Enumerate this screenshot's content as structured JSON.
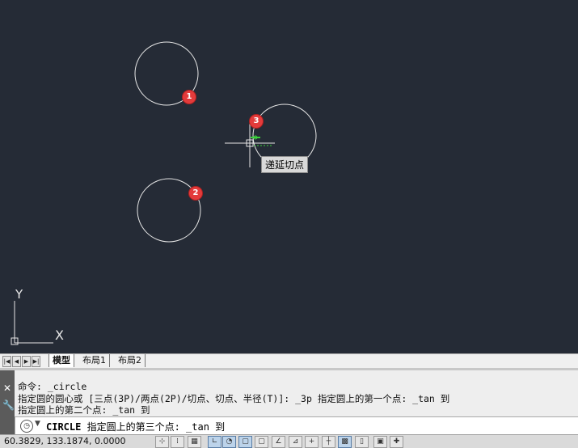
{
  "viewport": {
    "background": "#252b36",
    "markers": [
      {
        "label": "1",
        "color": "#e33b3b"
      },
      {
        "label": "2",
        "color": "#e33b3b"
      },
      {
        "label": "3",
        "color": "#e33b3b"
      }
    ],
    "tooltip": "递延切点",
    "ucs": {
      "x_label": "X",
      "y_label": "Y"
    }
  },
  "tabs": {
    "nav_icons": [
      "first-icon",
      "prev-icon",
      "next-icon",
      "last-icon"
    ],
    "items": [
      {
        "label": "模型",
        "active": true
      },
      {
        "label": "布局1",
        "active": false
      },
      {
        "label": "布局2",
        "active": false
      }
    ]
  },
  "command": {
    "history": [
      "命令: _circle",
      "指定圆的圆心或 [三点(3P)/两点(2P)/切点、切点、半径(T)]: _3p 指定圆上的第一个点: _tan 到",
      "指定圆上的第二个点: _tan 到"
    ],
    "input_keyword": "CIRCLE",
    "input_prompt": " 指定圆上的第三个点: _tan 到"
  },
  "status": {
    "coordinates": "60.3829,  133.1874, 0.0000",
    "buttons": [
      {
        "icon": "snap-icon",
        "on": false
      },
      {
        "icon": "grid-icon",
        "on": false
      },
      {
        "icon": "ortho-icon",
        "on": false
      },
      {
        "icon": "polar-icon",
        "on": true
      },
      {
        "icon": "osnap-icon",
        "on": true
      },
      {
        "icon": "3dosnap-icon",
        "on": true
      },
      {
        "icon": "otrack-icon",
        "on": false
      },
      {
        "icon": "ducs-icon",
        "on": false
      },
      {
        "icon": "dyn-icon",
        "on": false
      },
      {
        "icon": "lineweight-icon",
        "on": false
      },
      {
        "icon": "transparency-icon",
        "on": true
      },
      {
        "icon": "quickprops-icon",
        "on": false
      },
      {
        "icon": "selection-cycling-icon",
        "on": false
      },
      {
        "icon": "annotation-monitor-icon",
        "on": false
      }
    ]
  }
}
